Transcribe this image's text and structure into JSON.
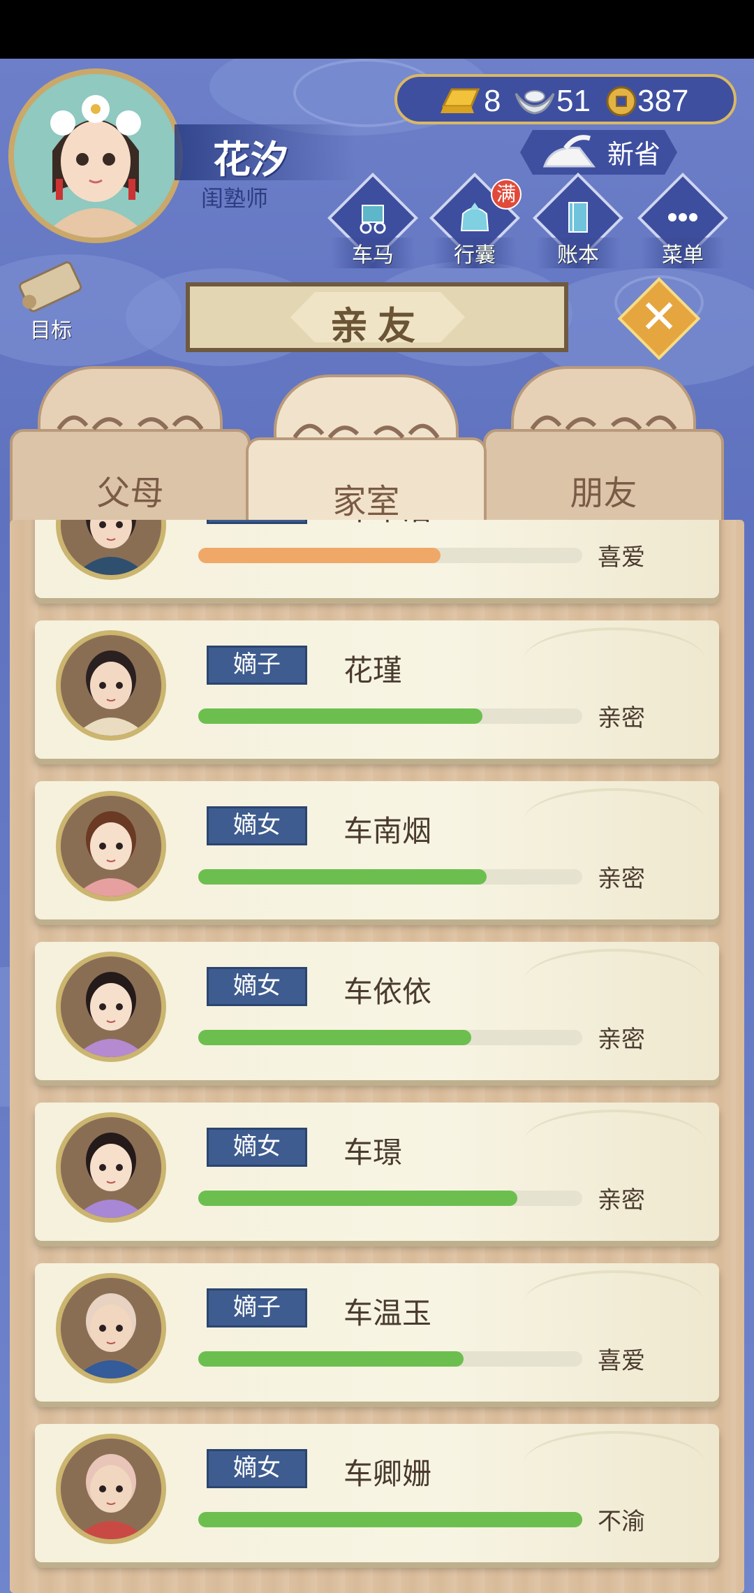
{
  "header": {
    "player_name": "花汐",
    "player_title": "闺塾师",
    "currency": {
      "gold": "8",
      "silver": "51",
      "coin": "387"
    },
    "save_label": "新省",
    "menu": [
      {
        "label": "车马",
        "icon": "carriage-icon"
      },
      {
        "label": "行囊",
        "icon": "bag-icon",
        "badge": "满"
      },
      {
        "label": "账本",
        "icon": "ledger-icon"
      },
      {
        "label": "菜单",
        "icon": "menu-dots-icon"
      }
    ],
    "goal_label": "目标"
  },
  "panel": {
    "title": "亲友",
    "tabs": [
      {
        "label": "父母"
      },
      {
        "label": "家室",
        "active": true
      },
      {
        "label": "朋友"
      }
    ]
  },
  "members": [
    {
      "relation": "丈夫",
      "name": "车中浩",
      "status": "喜爱",
      "affection": 0.63,
      "bar_color": "#f0a868"
    },
    {
      "relation": "嫡子",
      "name": "花瑾",
      "status": "亲密",
      "affection": 0.74,
      "bar_color": "#6cbf4f"
    },
    {
      "relation": "嫡女",
      "name": "车南烟",
      "status": "亲密",
      "affection": 0.75,
      "bar_color": "#6cbf4f"
    },
    {
      "relation": "嫡女",
      "name": "车依依",
      "status": "亲密",
      "affection": 0.71,
      "bar_color": "#6cbf4f"
    },
    {
      "relation": "嫡女",
      "name": "车璟",
      "status": "亲密",
      "affection": 0.83,
      "bar_color": "#6cbf4f"
    },
    {
      "relation": "嫡子",
      "name": "车温玉",
      "status": "喜爱",
      "affection": 0.69,
      "bar_color": "#6cbf4f"
    },
    {
      "relation": "嫡女",
      "name": "车卿姗",
      "status": "不渝",
      "affection": 1.0,
      "bar_color": "#6cbf4f"
    }
  ]
}
